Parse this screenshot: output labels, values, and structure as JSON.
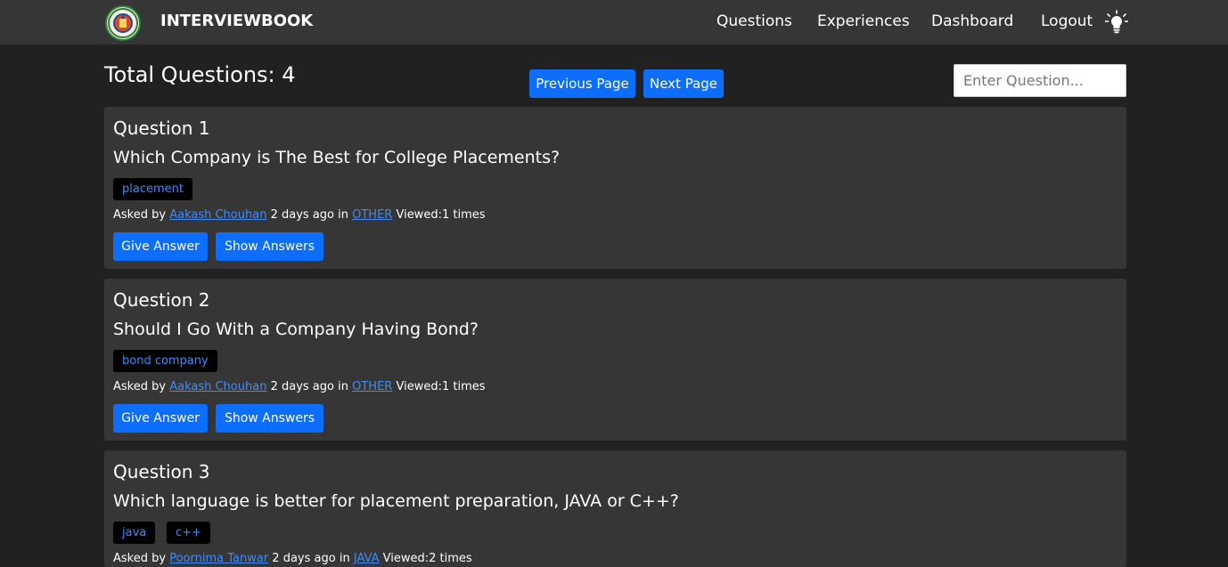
{
  "app": {
    "brand": "INTERVIEWBOOK"
  },
  "nav": {
    "questions": "Questions",
    "experiences": "Experiences",
    "dashboard": "Dashboard",
    "logout": "Logout"
  },
  "toolbar": {
    "total_label": "Total Questions: 4",
    "prev_label": "Previous Page",
    "next_label": "Next Page",
    "search_placeholder": "Enter Question..."
  },
  "labels": {
    "asked_by": "Asked by",
    "in": "in",
    "viewed_prefix": "Viewed:",
    "times": "times",
    "give_answer": "Give Answer",
    "show_answers": "Show Answers"
  },
  "questions": [
    {
      "number": "Question 1",
      "title": "Which Company is The Best for College Placements?",
      "tags": [
        "placement"
      ],
      "author": "Aakash Chouhan",
      "when": "2 days ago",
      "category": "OTHER",
      "views": "1"
    },
    {
      "number": "Question 2",
      "title": "Should I Go With a Company Having Bond?",
      "tags": [
        "bond company"
      ],
      "author": "Aakash Chouhan",
      "when": "2 days ago",
      "category": "OTHER",
      "views": "1"
    },
    {
      "number": "Question 3",
      "title": "Which language is better for placement preparation, JAVA or C++?",
      "tags": [
        "java",
        "c++"
      ],
      "author": "Poornima Tanwar",
      "when": "2 days ago",
      "category": "JAVA",
      "views": "2"
    }
  ],
  "colors": {
    "background": "#212121",
    "navbar": "#363636",
    "card": "#363636",
    "accent": "#0d6efd",
    "link": "#3d8bfd"
  },
  "icons": {
    "logo": "college-emblem-logo",
    "theme_toggle": "lightbulb-icon"
  }
}
